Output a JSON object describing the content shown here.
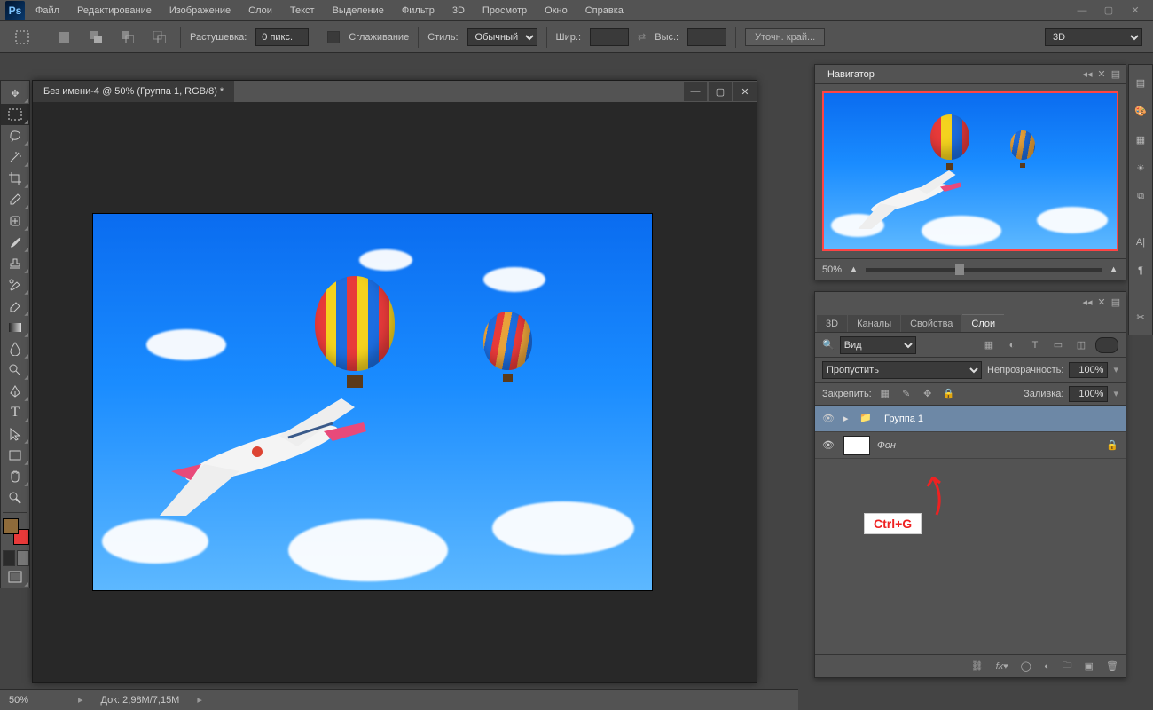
{
  "menu": {
    "items": [
      "Файл",
      "Редактирование",
      "Изображение",
      "Слои",
      "Текст",
      "Выделение",
      "Фильтр",
      "3D",
      "Просмотр",
      "Окно",
      "Справка"
    ]
  },
  "logo": "Ps",
  "options": {
    "feather_label": "Растушевка:",
    "feather_value": "0 пикс.",
    "antialias_label": "Сглаживание",
    "style_label": "Стиль:",
    "style_value": "Обычный",
    "width_label": "Шир.:",
    "height_label": "Выс.:",
    "refine_label": "Уточн. край...",
    "mode3d": "3D"
  },
  "document": {
    "tab_title": "Без имени-4 @ 50% (Группа 1, RGB/8) *"
  },
  "navigator": {
    "title": "Навигатор",
    "zoom": "50%"
  },
  "layers": {
    "tabs": [
      "3D",
      "Каналы",
      "Свойства",
      "Слои"
    ],
    "filter_label": "Вид",
    "blend_value": "Пропустить",
    "opacity_label": "Непрозрачность:",
    "opacity_value": "100%",
    "lock_label": "Закрепить:",
    "fill_label": "Заливка:",
    "fill_value": "100%",
    "rows": [
      {
        "name": "Группа 1",
        "type": "group",
        "selected": true
      },
      {
        "name": "Фон",
        "type": "layer",
        "locked": true
      }
    ]
  },
  "annotation": {
    "tip": "Ctrl+G"
  },
  "status": {
    "zoom": "50%",
    "doc": "Док: 2,98M/7,15M"
  }
}
